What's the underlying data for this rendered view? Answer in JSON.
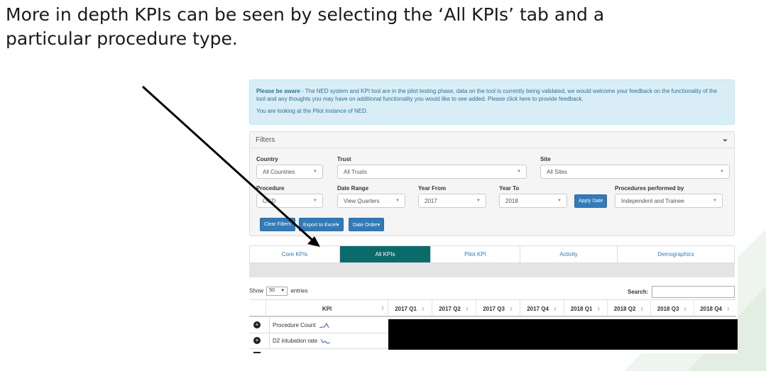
{
  "slide": {
    "line1": "More in depth KPIs can be seen by selecting the ‘All KPIs’ tab and a",
    "line2": "particular procedure type."
  },
  "alert": {
    "prefix": "Please be aware",
    "text": " - The NED system and KPI tool are in the pilot testing phase, data on the tool is currently being validated, we would welcome your feedback on the functionality of the tool and any thoughts you may have on additional functionality you would like to see added. Please click here to provide feedback.",
    "instance": "You are looking at the Pilot instance of NED."
  },
  "filters": {
    "title": "Filters",
    "country_label": "Country",
    "country_value": "All Countries",
    "trust_label": "Trust",
    "trust_value": "All Trusts",
    "site_label": "Site",
    "site_value": "All Sites",
    "procedure_label": "Procedure",
    "procedure_value": "OGD",
    "date_range_label": "Date Range",
    "date_range_value": "View Quarters",
    "year_from_label": "Year From",
    "year_from_value": "2017",
    "year_to_label": "Year To",
    "year_to_value": "2018",
    "apply_date": "Apply Date",
    "performed_by_label": "Procedures performed by",
    "performed_by_value": "Independent and Trainee",
    "clear_filters": "Clear Filters",
    "export_excel": "Export to Excel▾",
    "date_order": "Date Order▾"
  },
  "tabs": [
    "Core KPIs",
    "All KPIs",
    "Pilot KPI",
    "Activity",
    "Demographics"
  ],
  "table": {
    "show_prefix": "Show",
    "show_value": "50",
    "show_suffix": "entries",
    "search_label": "Search:",
    "kpi_header": "KPI",
    "quarters": [
      "2017 Q1",
      "2017 Q2",
      "2017 Q3",
      "2017 Q4",
      "2018 Q1",
      "2018 Q2",
      "2018 Q3",
      "2018 Q4"
    ],
    "rows": [
      "Procedure Count",
      "D2 intubation rate"
    ]
  },
  "colors": {
    "active_tab": "#0b6b6b",
    "button_blue": "#337ab7",
    "alert_bg": "#d9edf7"
  }
}
